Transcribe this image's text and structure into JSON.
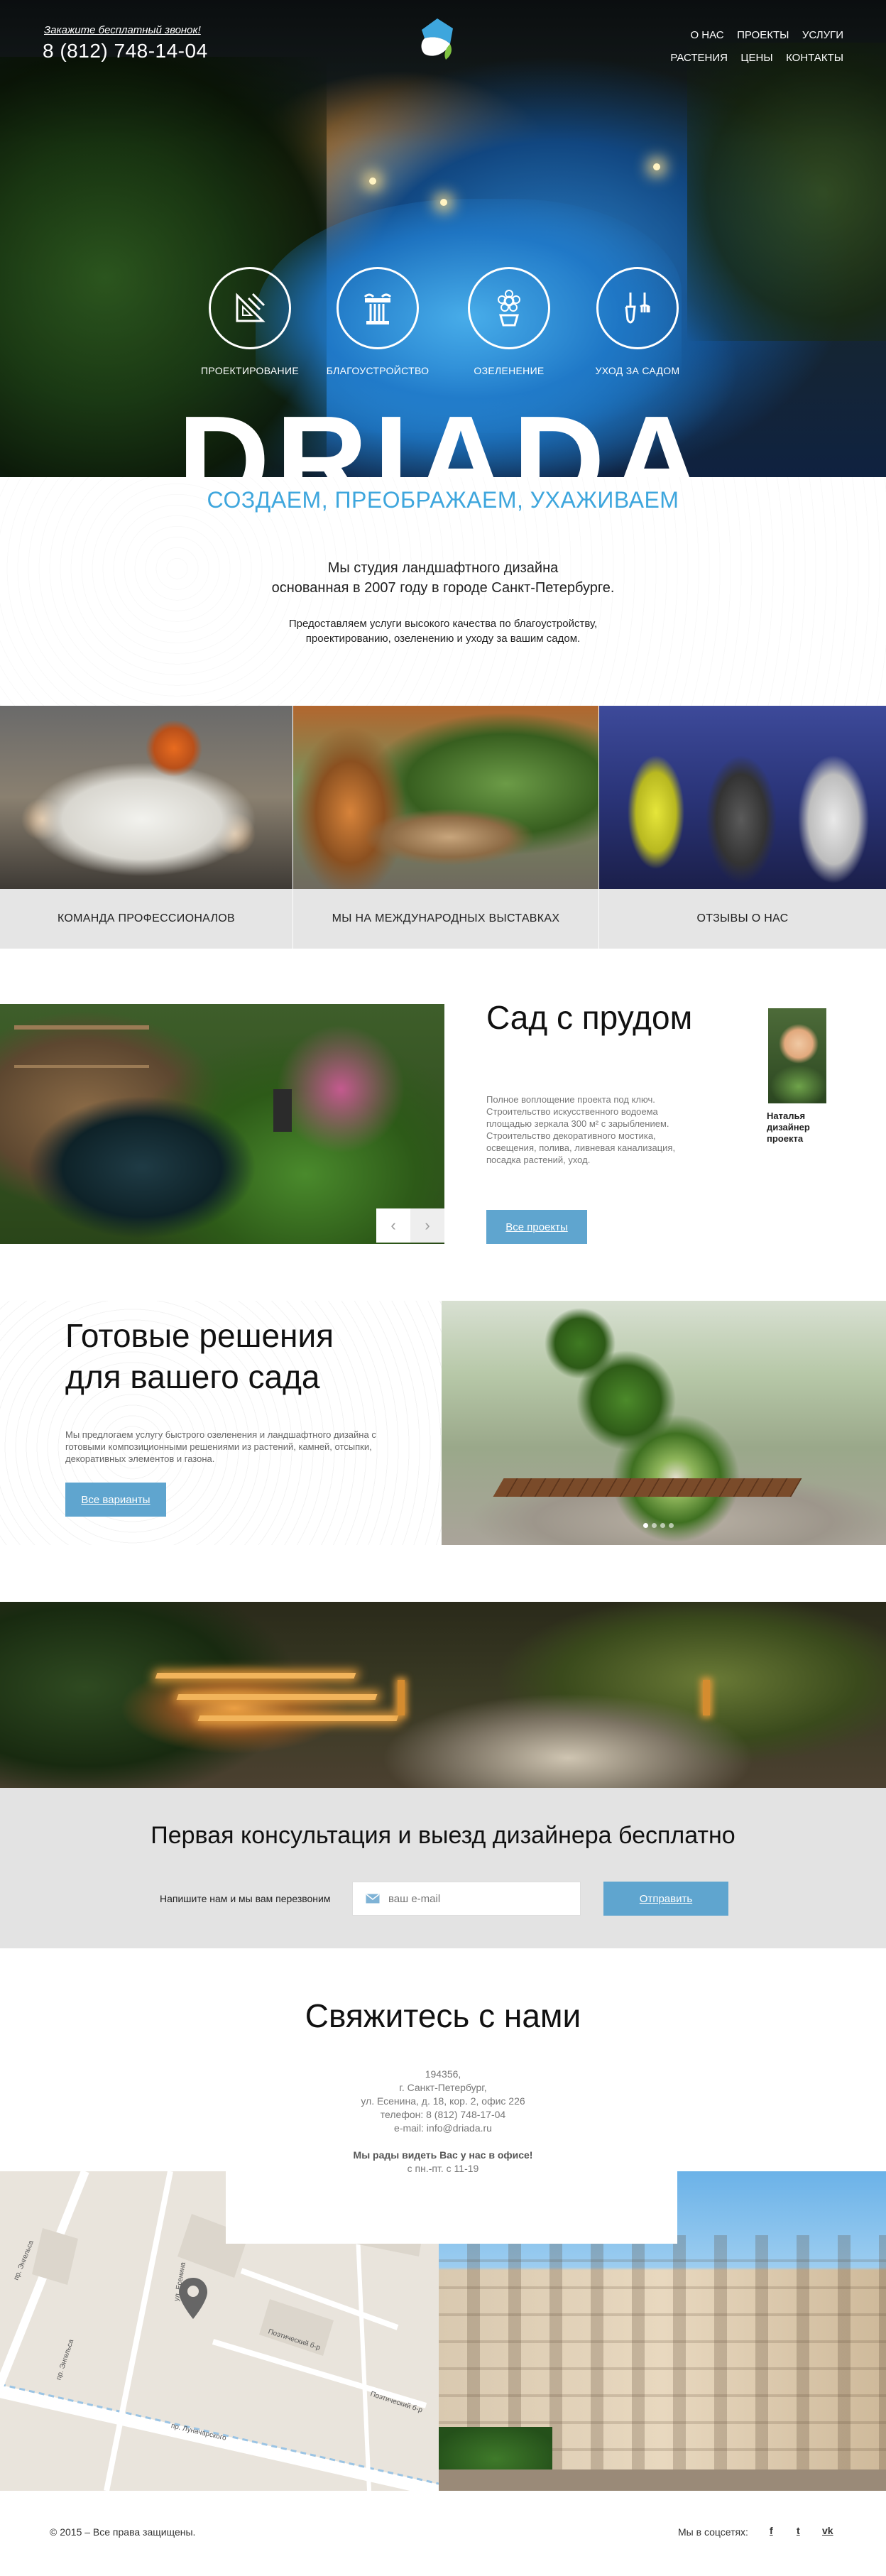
{
  "header": {
    "callback_link": "Закажите бесплатный звонок!",
    "phone": "8 (812) 748-14-04",
    "nav": [
      "О НАС",
      "ПРОЕКТЫ",
      "УСЛУГИ",
      "РАСТЕНИЯ",
      "ЦЕНЫ",
      "КОНТАКТЫ"
    ]
  },
  "hero": {
    "brand": "DRIADA",
    "services": [
      {
        "label": "ПРОЕКТИРОВАНИЕ",
        "icon": "drafting-tools-icon"
      },
      {
        "label": "БЛАГОУСТРОЙСТВО",
        "icon": "column-icon"
      },
      {
        "label": "ОЗЕЛЕНЕНИЕ",
        "icon": "flower-icon"
      },
      {
        "label": "УХОД ЗА САДОМ",
        "icon": "garden-tools-icon"
      }
    ]
  },
  "intro": {
    "tagline": "СОЗДАЕМ, ПРЕОБРАЖАЕМ, УХАЖИВАЕМ",
    "main_line1": "Мы студия ландшафтного дизайна",
    "main_line2": "основанная в 2007 году в городе Санкт-Петербурге.",
    "sub_line1": "Предоставляем услуги высокого качества по благоустройству,",
    "sub_line2": "проектированию, озеленению и уходу за вашим садом."
  },
  "tiles": [
    {
      "caption": "КОМАНДА ПРОФЕССИОНАЛОВ"
    },
    {
      "caption": "МЫ НА МЕЖДУНАРОДНЫХ ВЫСТАВКАХ"
    },
    {
      "caption": "ОТЗЫВЫ О НАС"
    }
  ],
  "project": {
    "title": "Сад с прудом",
    "description": "Полное воплощение проекта под ключ. Строительство искусственного водоема площадью зеркала 300 м² с зарыблением. Строительство декоративного мостика, освещения, полива, ливневая канализация, посадка растений, уход.",
    "button": "Все проекты",
    "designer_name": "Наталья",
    "designer_role": "дизайнер проекта",
    "prev": "‹",
    "next": "›"
  },
  "ready": {
    "title_line1": "Готовые решения",
    "title_line2": "для вашего сада",
    "description": "Мы предлогаем услугу быстрого озеленения и ландшафтного дизайна с готовыми композиционными решениями из растений, камней, отсыпки, декоративных элементов и газона.",
    "button": "Все варианты",
    "slides_total": 4,
    "slide_active": 1
  },
  "consult": {
    "title": "Первая консультация и выезд дизайнера бесплатно",
    "label": "Напишите нам и мы вам перезвоним",
    "email_placeholder": "ваш e-mail",
    "button": "Отправить"
  },
  "contacts": {
    "title": "Свяжитесь с нами",
    "zip": "194356,",
    "city": "г. Санкт-Петербург,",
    "street": "ул. Есенина, д. 18, кор. 2, офис 226",
    "phone": "телефон: 8 (812) 748-17-04",
    "email": "e-mail: info@driada.ru",
    "welcome": "Мы рады видеть Вас у нас в офисе!",
    "hours": "с пн.-пт. с 11-19"
  },
  "map": {
    "streets": [
      "пр. Энгельса",
      "ул. Есенина",
      "Поэтический б-р",
      "пр. Луначарского",
      "Поэтический б-р",
      "пр. Энгельса"
    ]
  },
  "footer": {
    "copyright": "© 2015 – Все права защищены.",
    "social_label": "Мы в соцсетях:",
    "social": [
      "f",
      "t",
      "vk"
    ]
  },
  "colors": {
    "accent": "#3ea6dd",
    "button": "#5fa5cf",
    "panel_gray": "#e3e3e3"
  }
}
